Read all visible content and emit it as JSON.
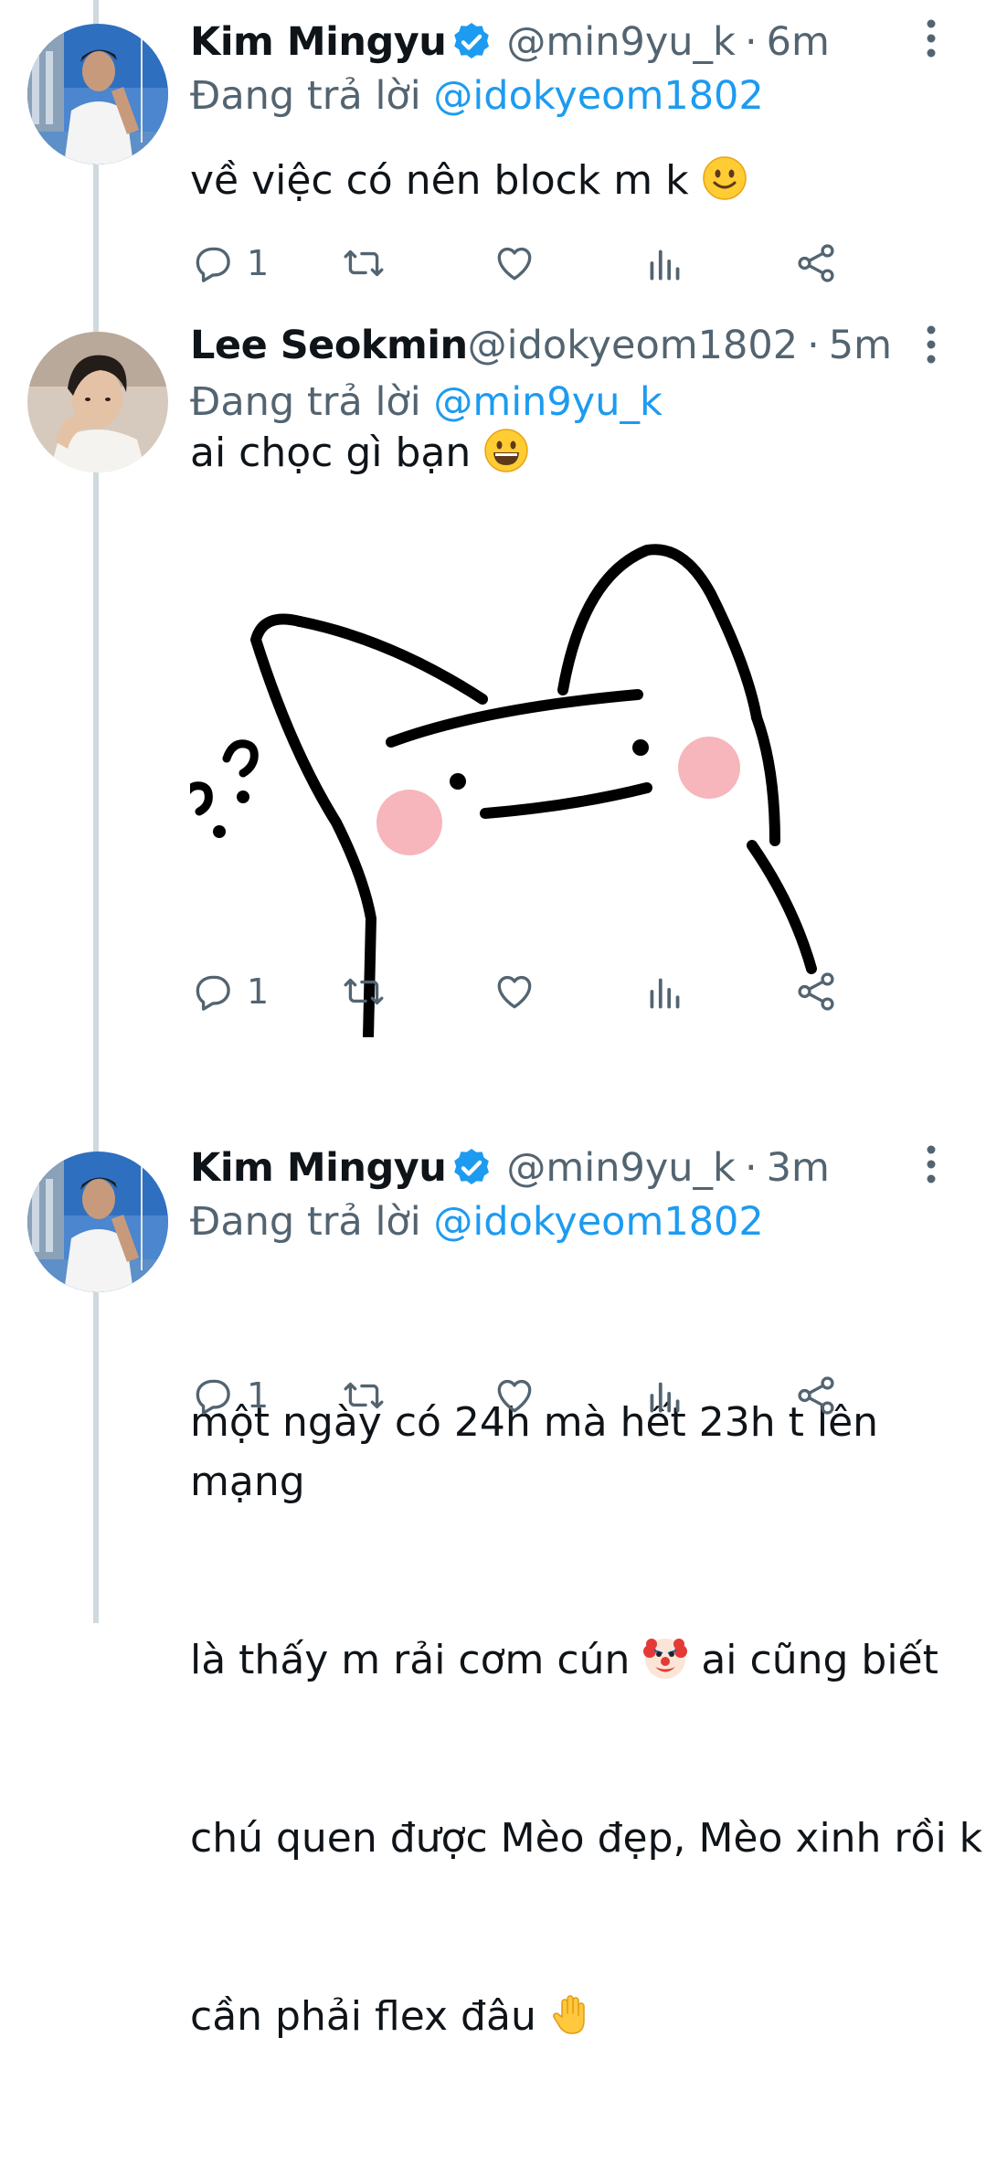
{
  "tweets": [
    {
      "display_name": "Kim Mingyu",
      "verified": true,
      "handle": "@min9yu_k",
      "time": "6m",
      "reply_prefix": "Đang trả lời",
      "reply_to": "@idokyeom1802",
      "text": "về việc có nên block m k",
      "trailing_emoji": "slightly-smiling-face-icon",
      "reply_count": "1"
    },
    {
      "display_name": "Lee Seokmin",
      "verified": false,
      "handle": "@idokyeom1802",
      "time": "5m",
      "reply_prefix": "Đang trả lời",
      "reply_to": "@min9yu_k",
      "text": "ai chọc gì bạn",
      "trailing_emoji": "grinning-face-icon",
      "reply_count": "1",
      "media": "cat-meme-sticker"
    },
    {
      "display_name": "Kim Mingyu",
      "verified": true,
      "handle": "@min9yu_k",
      "time": "3m",
      "reply_prefix": "Đang trả lời",
      "reply_to": "@idokyeom1802",
      "text_line1": "một ngày có 24h mà hết 23h t lên mạng",
      "text_line2a": "là thấy m rải cơm cún",
      "text_line2b": "ai cũng biết",
      "text_line3": "chú quen được Mèo đẹp, Mèo xinh rồi k",
      "text_line4": "cần phải flex đâu",
      "inline_emoji": "clown-face-icon",
      "trailing_emoji": "raised-hand-icon",
      "reply_count": "1"
    }
  ],
  "colors": {
    "accent": "#1d9bf0",
    "secondary_text": "#536471",
    "thread_line": "#cfd9de",
    "primary_text": "#0f1419"
  }
}
